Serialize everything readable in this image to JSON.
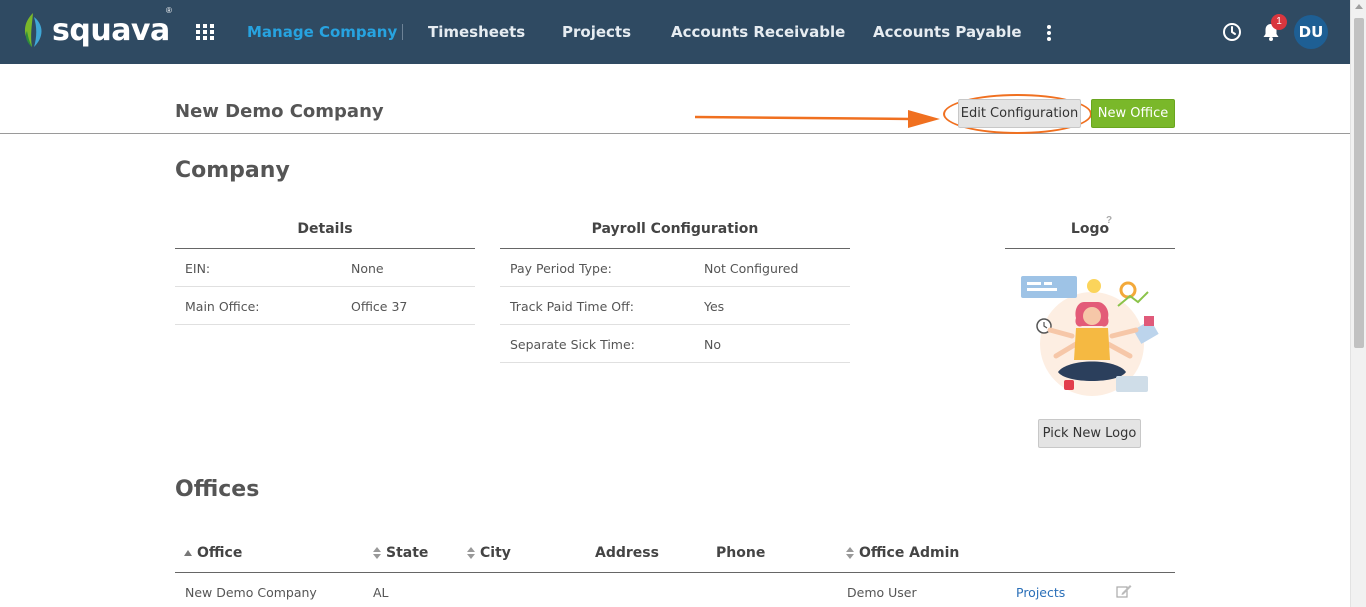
{
  "app": {
    "brand": "squava",
    "trademark": "®"
  },
  "nav": {
    "items": [
      {
        "label": "Manage Company",
        "active": true
      },
      {
        "label": "Timesheets"
      },
      {
        "label": "Projects"
      },
      {
        "label": "Accounts Receivable"
      },
      {
        "label": "Accounts Payable"
      }
    ],
    "notification_count": "1",
    "avatar_initials": "DU",
    "icons": [
      "apps-grid-icon",
      "more-vertical-icon",
      "clock-icon",
      "bell-icon"
    ]
  },
  "page": {
    "title": "New Demo Company",
    "edit_config_label": "Edit Configuration",
    "new_office_label": "New Office"
  },
  "company": {
    "heading": "Company",
    "details": {
      "header": "Details",
      "rows": [
        {
          "label": "EIN:",
          "value": "None"
        },
        {
          "label": "Main Office:",
          "value": "Office 37"
        }
      ]
    },
    "payroll": {
      "header": "Payroll Configuration",
      "rows": [
        {
          "label": "Pay Period Type:",
          "value": "Not Configured"
        },
        {
          "label": "Track Paid Time Off:",
          "value": "Yes"
        },
        {
          "label": "Separate Sick Time:",
          "value": "No"
        }
      ]
    },
    "logo": {
      "header": "Logo",
      "help": "?",
      "pick_label": "Pick New Logo"
    }
  },
  "offices": {
    "heading": "Offices",
    "columns": [
      "Office",
      "State",
      "City",
      "Address",
      "Phone",
      "Office Admin"
    ],
    "rows": [
      {
        "office": "New Demo Company",
        "state": "AL",
        "city": "",
        "address": "",
        "phone": "",
        "admin": "Demo User",
        "link": "Projects"
      }
    ]
  },
  "colors": {
    "topbar": "#2f4a62",
    "active_nav": "#27a3e0",
    "new_button": "#7ab82a",
    "annotation": "#f07020",
    "link": "#2a6fb8"
  }
}
